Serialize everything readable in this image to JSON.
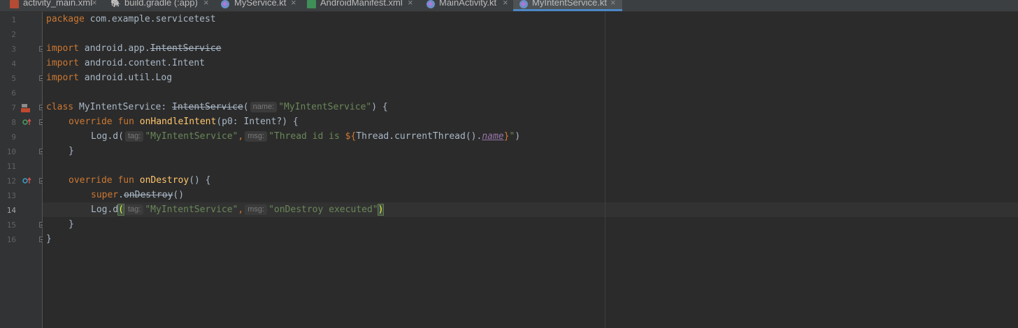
{
  "tabs": [
    {
      "label": "activity_main.xml",
      "icon": "xml-file-icon",
      "active": false
    },
    {
      "label": "build.gradle (:app)",
      "icon": "gradle-icon",
      "active": false
    },
    {
      "label": "MyService.kt",
      "icon": "kotlin-file-icon",
      "active": false
    },
    {
      "label": "AndroidManifest.xml",
      "icon": "manifest-file-icon",
      "active": false
    },
    {
      "label": "MainActivity.kt",
      "icon": "kotlin-file-icon",
      "active": false
    },
    {
      "label": "MyIntentService.kt",
      "icon": "kotlin-file-icon",
      "active": true
    }
  ],
  "close_glyph": "×",
  "gutter": {
    "line_numbers": [
      "1",
      "2",
      "3",
      "4",
      "5",
      "6",
      "7",
      "8",
      "9",
      "10",
      "11",
      "12",
      "13",
      "14",
      "15",
      "16"
    ],
    "current_line": "14",
    "icons": {
      "class_icon": "android-class-icon",
      "override_icon": "override-method-icon"
    }
  },
  "code": {
    "l1": {
      "kw": "package",
      "rest": " com.example.servicetest"
    },
    "l3": {
      "kw": "import",
      "pre": " android.app.",
      "strike": "IntentService"
    },
    "l4": {
      "kw": "import",
      "rest": " android.content.Intent"
    },
    "l5": {
      "kw": "import",
      "rest": " android.util.Log"
    },
    "l7": {
      "kw": "class",
      "name": " MyIntentService: ",
      "super": "IntentService",
      "open": "(",
      "hint": "name:",
      "str": "\"MyIntentService\"",
      "close": ") {"
    },
    "l8": {
      "kw": "override fun ",
      "fn": "onHandleIntent",
      "rest": "(p0: Intent?) {"
    },
    "l9": {
      "pre": "Log.d(",
      "hint1": "tag:",
      "str1": "\"MyIntentService\"",
      "comma": ",",
      "hint2": "msg:",
      "str2a": "\"Thread id is ",
      "tmpl_open": "${",
      "call": "Thread.currentThread().",
      "prop": "name",
      "tmpl_close": "}",
      "str2b": "\"",
      "close": ")"
    },
    "l10": {
      "rest": "}"
    },
    "l12": {
      "kw": "override fun ",
      "fn": "onDestroy",
      "rest": "() {"
    },
    "l13": {
      "kw": "super",
      "dot": ".",
      "strike": "onDestroy",
      "rest": "()"
    },
    "l14": {
      "pre": "Log.d",
      "open": "(",
      "hint1": "tag:",
      "str1": "\"MyIntentService\"",
      "comma": ",",
      "hint2": "msg:",
      "str2": "\"onDestroy executed\"",
      "close": ")"
    },
    "l15": {
      "rest": "}"
    },
    "l16": {
      "rest": "}"
    }
  },
  "colors": {
    "keyword": "#cc7832",
    "function": "#ffc66d",
    "string": "#6a8759",
    "text": "#a9b7c6",
    "background": "#2b2b2b",
    "active_tab_underline": "#4a88c7"
  }
}
